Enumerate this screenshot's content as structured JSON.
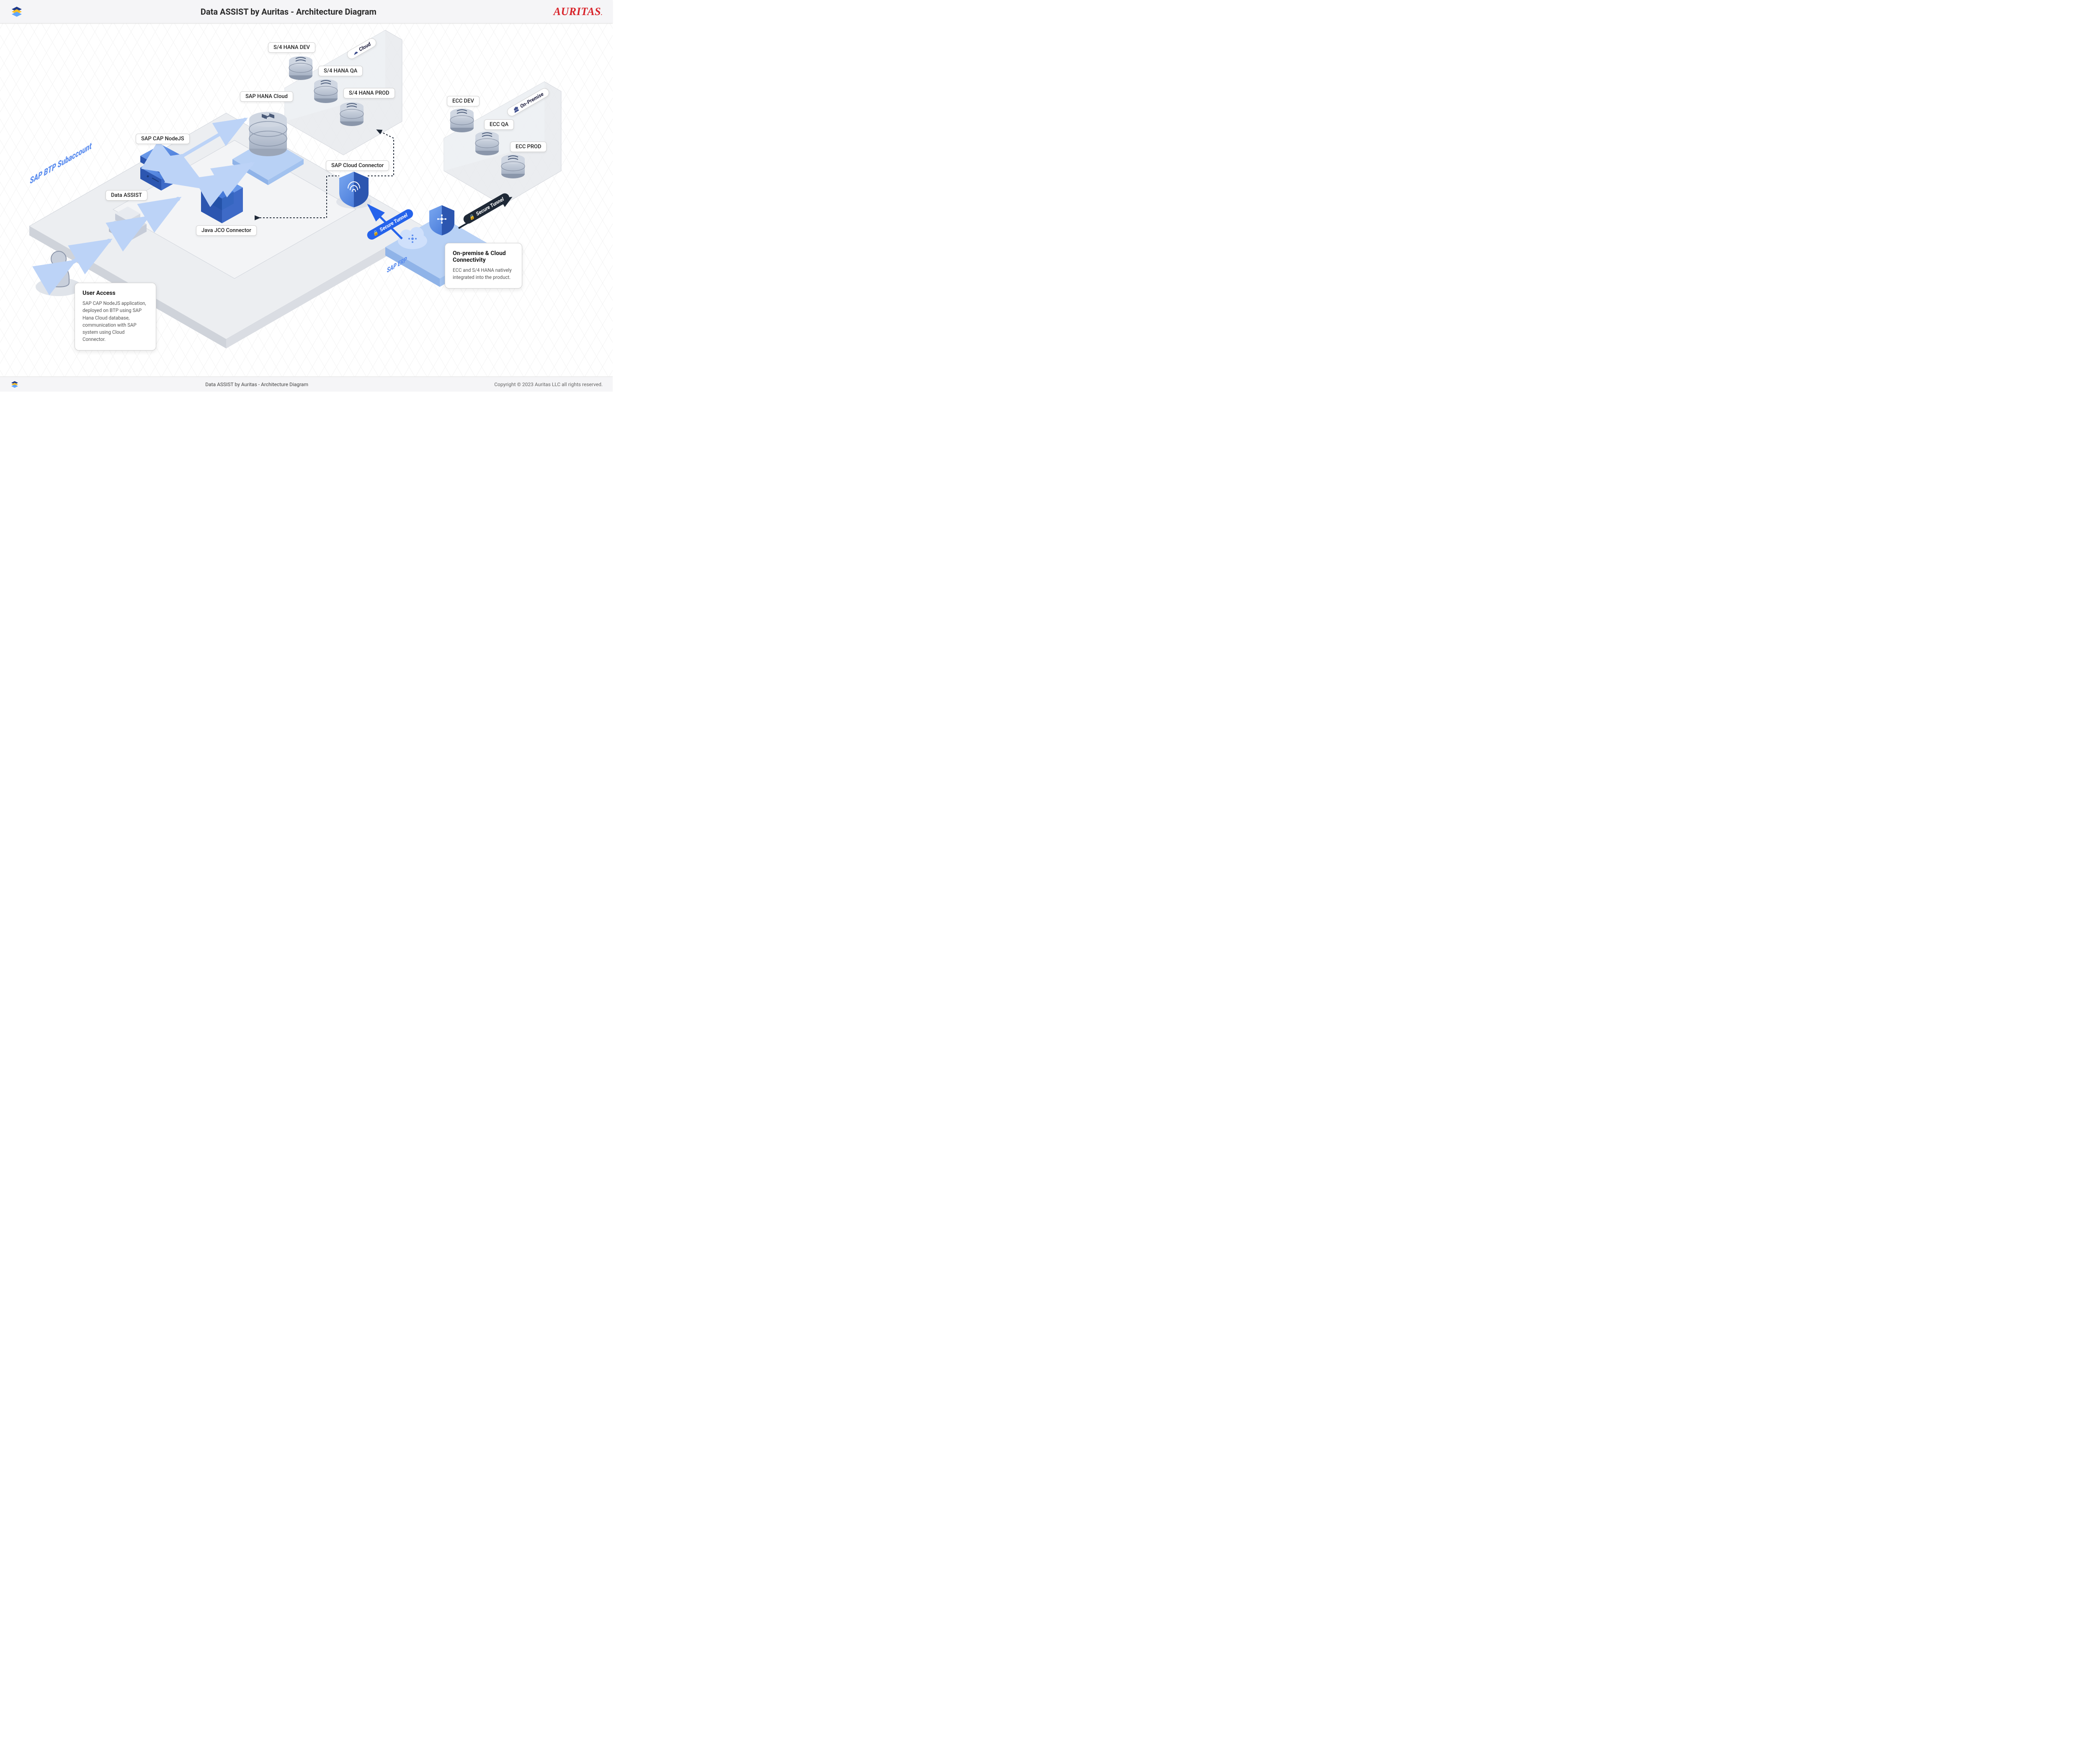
{
  "header": {
    "title": "Data ASSIST by Auritas - Architecture Diagram",
    "brand": "AURITAS"
  },
  "footer": {
    "title": "Data ASSIST by Auritas - Architecture Diagram",
    "copyright": "Copyright © 2023 Auritas LLC all rights reserved."
  },
  "platform": {
    "main_label": "SAP BTP Subaccount",
    "erp_label": "SAP ERP"
  },
  "nodes": {
    "data_assist": "Data ASSIST",
    "sap_cap_nodejs": "SAP CAP NodeJS",
    "sap_hana_cloud": "SAP HANA Cloud",
    "java_jco_connector": "Java JCO Connector",
    "sap_cloud_connector": "SAP Cloud Connector",
    "s4_hana_dev": "S/4 HANA DEV",
    "s4_hana_qa": "S/4 HANA QA",
    "s4_hana_prod": "S/4 HANA PROD",
    "ecc_dev": "ECC DEV",
    "ecc_qa": "ECC QA",
    "ecc_prod": "ECC PROD"
  },
  "zones": {
    "cloud": "Cloud",
    "on_premise": "On-Premise"
  },
  "tunnels": {
    "secure_tunnel_1": "Secure Tunnel",
    "secure_tunnel_2": "Secure Tunnel"
  },
  "cards": {
    "user_access": {
      "title": "User Access",
      "body": "SAP CAP NodeJS application, deployed on BTP using SAP Hana Cloud database, communication with SAP system using Cloud Connector."
    },
    "connectivity": {
      "title": "On-premise & Cloud Connectivity",
      "body": "ECC and S/4 HANA natively integrated into the product."
    }
  },
  "colors": {
    "brand_red": "#d8232a",
    "primary_blue": "#2563eb",
    "light_blue": "#9fc1f4",
    "platform_gray": "#e8e9eb",
    "dark": "#1f2937"
  }
}
